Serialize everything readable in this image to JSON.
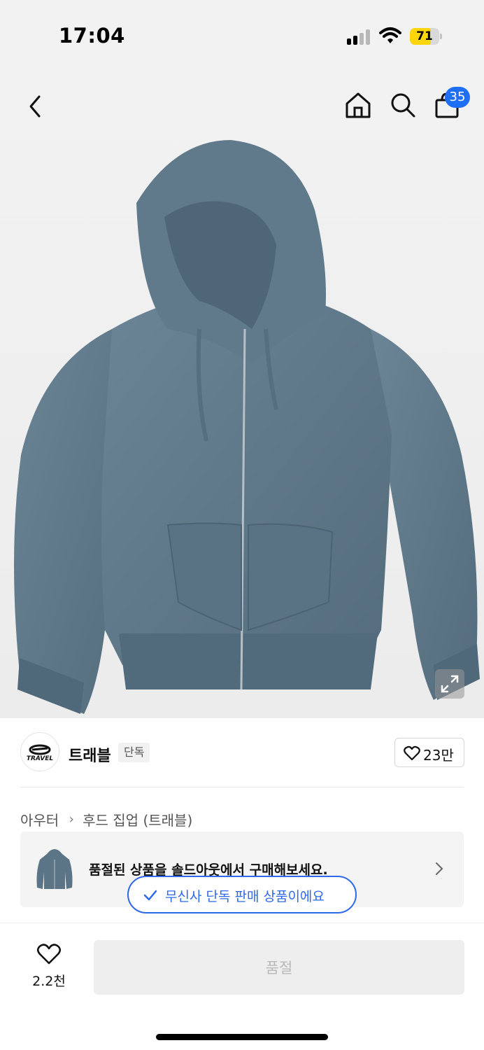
{
  "status_bar": {
    "time": "17:04",
    "battery": "71",
    "battery_color": "#ffd60a"
  },
  "header": {
    "cart_count": "35",
    "badge_color": "#1e6ff5"
  },
  "brand": {
    "logo_text": "TRAVEL",
    "name": "트래블",
    "tag": "단독",
    "likes": "23만"
  },
  "breadcrumb": {
    "level1": "아우터",
    "level2": "후드 집업 (트래블)"
  },
  "soldout": {
    "text": "품절된 상품을 솔드아웃에서 구매해보세요."
  },
  "exclusive": {
    "label": "무신사 단독 판매 상품이에요",
    "color": "#2f68e8"
  },
  "bottom": {
    "wish_count": "2.2천",
    "buy_label": "품절"
  },
  "product": {
    "color": "#5c7586"
  }
}
